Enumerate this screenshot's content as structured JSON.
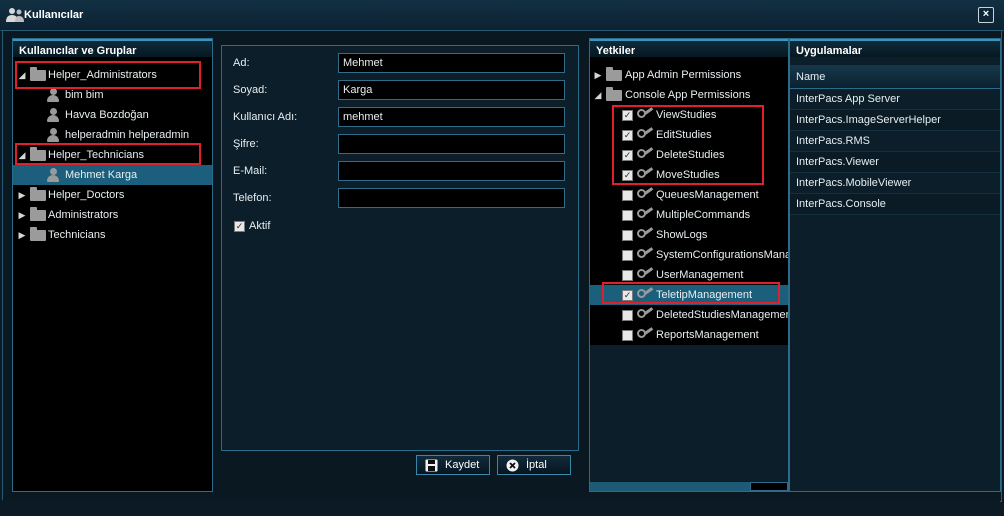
{
  "window": {
    "title": "Kullanıcılar",
    "close_label": "×"
  },
  "users_panel": {
    "title": "Kullanıcılar ve Gruplar",
    "items": [
      {
        "label": "Helper_Administrators",
        "type": "group",
        "expanded": true
      },
      {
        "label": "bim bim",
        "type": "user"
      },
      {
        "label": "Havva Bozdoğan",
        "type": "user"
      },
      {
        "label": "helperadmin helperadmin",
        "type": "user"
      },
      {
        "label": "Helper_Technicians",
        "type": "group",
        "expanded": true
      },
      {
        "label": "Mehmet Karga",
        "type": "user",
        "selected": true
      },
      {
        "label": "Helper_Doctors",
        "type": "group",
        "expanded": false
      },
      {
        "label": "Administrators",
        "type": "group",
        "expanded": false
      },
      {
        "label": "Technicians",
        "type": "group",
        "expanded": false
      }
    ]
  },
  "form": {
    "fields": [
      {
        "label": "Ad:",
        "value": "Mehmet"
      },
      {
        "label": "Soyad:",
        "value": "Karga"
      },
      {
        "label": "Kullanıcı Adı:",
        "value": "mehmet"
      },
      {
        "label": "Şifre:",
        "value": ""
      },
      {
        "label": "E-Mail:",
        "value": ""
      },
      {
        "label": "Telefon:",
        "value": ""
      }
    ],
    "active_label": "Aktif",
    "active_checked": true,
    "save_label": "Kaydet",
    "cancel_label": "İptal"
  },
  "permissions_panel": {
    "title": "Yetkiler",
    "groups": [
      {
        "label": "App Admin Permissions",
        "expanded": false
      },
      {
        "label": "Console App Permissions",
        "expanded": true
      }
    ],
    "items": [
      {
        "label": "ViewStudies",
        "checked": true
      },
      {
        "label": "EditStudies",
        "checked": true
      },
      {
        "label": "DeleteStudies",
        "checked": true
      },
      {
        "label": "MoveStudies",
        "checked": true
      },
      {
        "label": "QueuesManagement",
        "checked": false
      },
      {
        "label": "MultipleCommands",
        "checked": false
      },
      {
        "label": "ShowLogs",
        "checked": false
      },
      {
        "label": "SystemConfigurationsManagement",
        "checked": false
      },
      {
        "label": "UserManagement",
        "checked": false
      },
      {
        "label": "TeletipManagement",
        "checked": true,
        "selected": true
      },
      {
        "label": "DeletedStudiesManagement",
        "checked": false
      },
      {
        "label": "ReportsManagement",
        "checked": false
      }
    ]
  },
  "apps_panel": {
    "title": "Uygulamalar",
    "column_header": "Name",
    "rows": [
      "InterPacs App Server",
      "InterPacs.ImageServerHelper",
      "InterPacs.RMS",
      "InterPacs.Viewer",
      "InterPacs.MobileViewer",
      "InterPacs.Console"
    ]
  },
  "colors": {
    "highlight": "#e0202a",
    "selection": "#1b5f7c",
    "accent": "#3c95bd"
  }
}
